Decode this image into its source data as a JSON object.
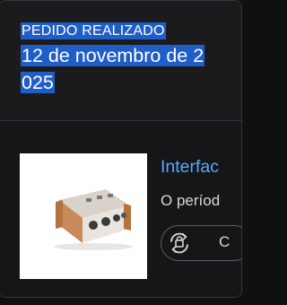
{
  "order": {
    "status_label": "PEDIDO REALIZADO",
    "date": "12 de novembro de 2 025"
  },
  "item": {
    "title": "Interfac",
    "subtitle": "O períod",
    "image": "audio-interface-product-photo",
    "rebuy_icon": "rebuy-cycle-icon",
    "rebuy_label": "C"
  },
  "colors": {
    "background": "#0f1111",
    "card": "#1b1b1d",
    "selection": "#1f5ec7",
    "link": "#58a8ff",
    "text": "#d8d8d8"
  }
}
